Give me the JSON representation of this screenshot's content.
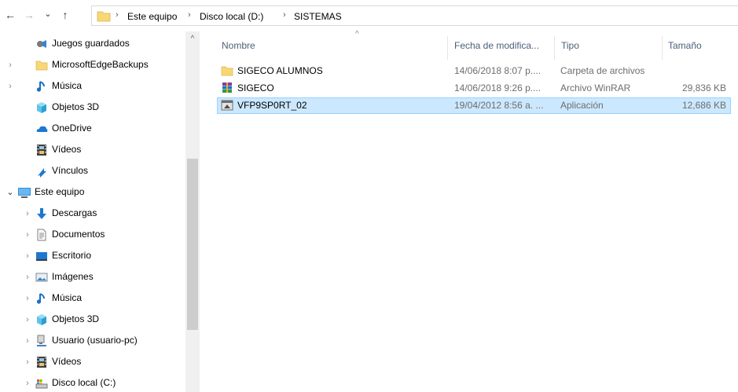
{
  "address": {
    "back_arrow": "←",
    "forward_arrow": "→",
    "recent_chevron": "⌄",
    "up_arrow": "↑",
    "separator": "›",
    "crumbs": [
      "Este equipo",
      "Disco local (D:)",
      "SISTEMAS"
    ]
  },
  "nav": {
    "items": [
      {
        "label": "Juegos guardados",
        "icon": "saved-games-icon",
        "chevron": ""
      },
      {
        "label": "MicrosoftEdgeBackups",
        "icon": "folder-icon",
        "chevron": "›"
      },
      {
        "label": "Música",
        "icon": "music-icon",
        "chevron": "›"
      },
      {
        "label": "Objetos 3D",
        "icon": "objects-3d-icon",
        "chevron": ""
      },
      {
        "label": "OneDrive",
        "icon": "onedrive-icon",
        "chevron": ""
      },
      {
        "label": "Vídeos",
        "icon": "videos-icon",
        "chevron": ""
      },
      {
        "label": "Vínculos",
        "icon": "links-icon",
        "chevron": ""
      },
      {
        "label": "Este equipo",
        "icon": "this-pc-icon",
        "chevron": "⌄"
      },
      {
        "label": "Descargas",
        "icon": "downloads-icon",
        "chevron": "›"
      },
      {
        "label": "Documentos",
        "icon": "documents-icon",
        "chevron": "›"
      },
      {
        "label": "Escritorio",
        "icon": "desktop-icon",
        "chevron": "›"
      },
      {
        "label": "Imágenes",
        "icon": "pictures-icon",
        "chevron": "›"
      },
      {
        "label": "Música",
        "icon": "music-icon",
        "chevron": "›"
      },
      {
        "label": "Objetos 3D",
        "icon": "objects-3d-icon",
        "chevron": "›"
      },
      {
        "label": "Usuario (usuario-pc)",
        "icon": "user-network-icon",
        "chevron": "›"
      },
      {
        "label": "Vídeos",
        "icon": "videos-icon",
        "chevron": "›"
      },
      {
        "label": "Disco local (C:)",
        "icon": "drive-icon",
        "chevron": "›"
      }
    ],
    "scroll_up": "^"
  },
  "list": {
    "columns": {
      "name": "Nombre",
      "date": "Fecha de modifica...",
      "type": "Tipo",
      "size": "Tamaño",
      "sort_indicator": "^"
    },
    "files": [
      {
        "name": "SIGECO ALUMNOS",
        "date": "14/06/2018 8:07 p....",
        "type": "Carpeta de archivos",
        "size": "",
        "icon": "folder-icon",
        "selected": false
      },
      {
        "name": "SIGECO",
        "date": "14/06/2018 9:26 p....",
        "type": "Archivo WinRAR",
        "size": "29,836 KB",
        "icon": "winrar-archive-icon",
        "selected": false
      },
      {
        "name": "VFP9SP0RT_02",
        "date": "19/04/2012 8:56 a. ...",
        "type": "Aplicación",
        "size": "12,686 KB",
        "icon": "application-icon",
        "selected": true
      }
    ]
  },
  "colors": {
    "selection_bg": "#cce8ff",
    "selection_border": "#99d1ff",
    "header_text": "#4c607a",
    "folder_yellow": "#f8d775"
  }
}
